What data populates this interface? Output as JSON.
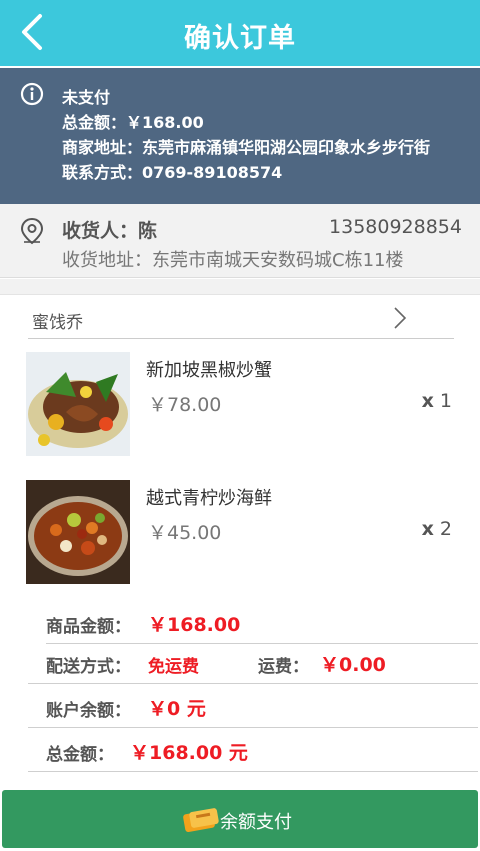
{
  "header": {
    "title": "确认订单"
  },
  "order": {
    "status": "未支付",
    "total": "总金额：￥168.00",
    "merchant_address": "商家地址：东莞市麻涌镇华阳湖公园印象水乡步行街",
    "contact": "联系方式：0769-89108574"
  },
  "receiver": {
    "name": "收货人：陈",
    "phone": "13580928854",
    "address": "收货地址：东莞市南城天安数码城C栋11楼"
  },
  "shop": {
    "name": "蜜饯乔"
  },
  "items": [
    {
      "name": "新加坡黑椒炒蟹",
      "price": "￥78.00",
      "qty_prefix": "x",
      "qty": "1"
    },
    {
      "name": "越式青柠炒海鲜",
      "price": "￥45.00",
      "qty_prefix": "x",
      "qty": "2"
    }
  ],
  "summary": {
    "goods_label": "商品金额：",
    "goods_value": "￥168.00",
    "delivery_label": "配送方式：",
    "delivery_value": "免运费",
    "freight_label": "运费：",
    "freight_value": "￥0.00",
    "balance_label": "账户余额：",
    "balance_value": "￥0 元",
    "total_label": "总金额：",
    "total_value": "￥168.00 元"
  },
  "pay_button": {
    "label": "余额支付"
  },
  "colors": {
    "header_bg": "#3cc8dc",
    "order_bg": "#4f6782",
    "price_red": "#ee1c24",
    "pay_green": "#339960"
  }
}
